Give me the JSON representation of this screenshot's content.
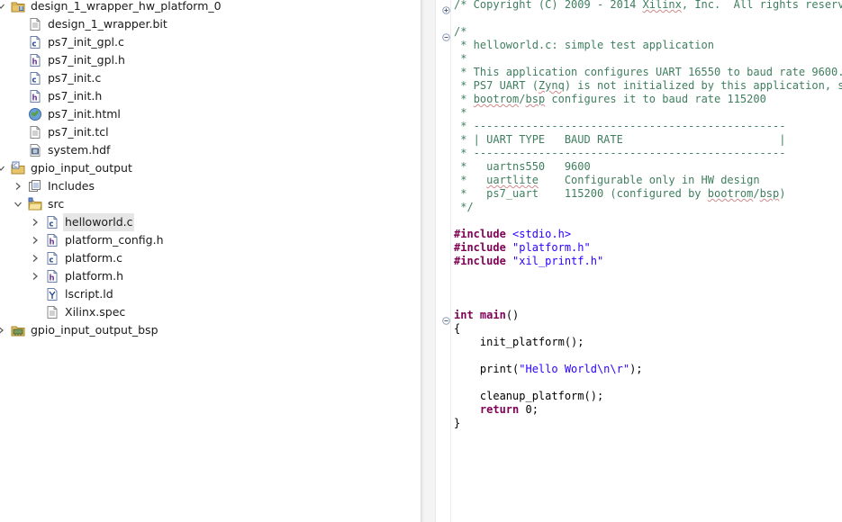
{
  "explorer": {
    "items": [
      {
        "label": "design_1_wrapper_hw_platform_0",
        "icon": "project-folder-icon",
        "depth": 0,
        "expander": "expanded"
      },
      {
        "label": "design_1_wrapper.bit",
        "icon": "text-file-icon",
        "depth": 1,
        "expander": "none"
      },
      {
        "label": "ps7_init_gpl.c",
        "icon": "c-file-icon",
        "depth": 1,
        "expander": "none"
      },
      {
        "label": "ps7_init_gpl.h",
        "icon": "h-file-icon",
        "depth": 1,
        "expander": "none"
      },
      {
        "label": "ps7_init.c",
        "icon": "c-file-icon",
        "depth": 1,
        "expander": "none"
      },
      {
        "label": "ps7_init.h",
        "icon": "h-file-icon",
        "depth": 1,
        "expander": "none"
      },
      {
        "label": "ps7_init.html",
        "icon": "web-file-icon",
        "depth": 1,
        "expander": "none"
      },
      {
        "label": "ps7_init.tcl",
        "icon": "text-file-icon",
        "depth": 1,
        "expander": "none"
      },
      {
        "label": "system.hdf",
        "icon": "hdf-file-icon",
        "depth": 1,
        "expander": "none"
      },
      {
        "label": "gpio_input_output",
        "icon": "c-project-icon",
        "depth": 0,
        "expander": "expanded"
      },
      {
        "label": "Includes",
        "icon": "includes-icon",
        "depth": 1,
        "expander": "collapsed"
      },
      {
        "label": "src",
        "icon": "source-folder-icon",
        "depth": 1,
        "expander": "expanded"
      },
      {
        "label": "helloworld.c",
        "icon": "c-file-icon",
        "depth": 2,
        "expander": "collapsed",
        "selected": true
      },
      {
        "label": "platform_config.h",
        "icon": "h-file-icon",
        "depth": 2,
        "expander": "collapsed"
      },
      {
        "label": "platform.c",
        "icon": "c-file-icon",
        "depth": 2,
        "expander": "collapsed"
      },
      {
        "label": "platform.h",
        "icon": "h-file-icon",
        "depth": 2,
        "expander": "collapsed"
      },
      {
        "label": "lscript.ld",
        "icon": "linker-script-icon",
        "depth": 2,
        "expander": "none"
      },
      {
        "label": "Xilinx.spec",
        "icon": "text-file-icon",
        "depth": 2,
        "expander": "none"
      },
      {
        "label": "gpio_input_output_bsp",
        "icon": "bsp-project-icon",
        "depth": 0,
        "expander": "collapsed"
      }
    ]
  },
  "editor": {
    "lines": [
      {
        "fold": "plus",
        "segs": [
          {
            "t": "/* Copyright (C) 2009 - 2014 ",
            "c": "cm"
          },
          {
            "t": "Xilinx",
            "c": "cm sq"
          },
          {
            "t": ", Inc.  All rights reserved.",
            "c": "cm"
          }
        ]
      },
      {
        "segs": []
      },
      {
        "fold": "minus",
        "segs": [
          {
            "t": "/*",
            "c": "cm"
          }
        ]
      },
      {
        "segs": [
          {
            "t": " * helloworld.c: simple test application",
            "c": "cm"
          }
        ]
      },
      {
        "segs": [
          {
            "t": " *",
            "c": "cm"
          }
        ]
      },
      {
        "segs": [
          {
            "t": " * This application configures UART 16550 to baud rate 9600.",
            "c": "cm"
          }
        ]
      },
      {
        "segs": [
          {
            "t": " * PS7 UART (",
            "c": "cm"
          },
          {
            "t": "Zynq",
            "c": "cm sq"
          },
          {
            "t": ") is not initialized by this application, since",
            "c": "cm"
          }
        ]
      },
      {
        "segs": [
          {
            "t": " * ",
            "c": "cm"
          },
          {
            "t": "bootrom",
            "c": "cm sq"
          },
          {
            "t": "/",
            "c": "cm"
          },
          {
            "t": "bsp",
            "c": "cm sq"
          },
          {
            "t": " configures it to baud rate 115200",
            "c": "cm"
          }
        ]
      },
      {
        "segs": [
          {
            "t": " *",
            "c": "cm"
          }
        ]
      },
      {
        "segs": [
          {
            "t": " * ------------------------------------------------",
            "c": "cm"
          }
        ]
      },
      {
        "segs": [
          {
            "t": " * | UART TYPE   BAUD RATE                        |",
            "c": "cm"
          }
        ]
      },
      {
        "segs": [
          {
            "t": " * ------------------------------------------------",
            "c": "cm"
          }
        ]
      },
      {
        "segs": [
          {
            "t": " *   uartns550   9600",
            "c": "cm"
          }
        ]
      },
      {
        "segs": [
          {
            "t": " *   ",
            "c": "cm"
          },
          {
            "t": "uartlite",
            "c": "cm sq"
          },
          {
            "t": "    Configurable only in HW design",
            "c": "cm"
          }
        ]
      },
      {
        "segs": [
          {
            "t": " *   ps7_uart    115200 (configured by ",
            "c": "cm"
          },
          {
            "t": "bootrom",
            "c": "cm sq"
          },
          {
            "t": "/",
            "c": "cm"
          },
          {
            "t": "bsp",
            "c": "cm sq"
          },
          {
            "t": ")",
            "c": "cm"
          }
        ]
      },
      {
        "segs": [
          {
            "t": " */",
            "c": "cm"
          }
        ]
      },
      {
        "segs": []
      },
      {
        "segs": [
          {
            "t": "#include",
            "c": "kw"
          },
          {
            "t": " ",
            "c": ""
          },
          {
            "t": "<stdio.h>",
            "c": "str"
          }
        ]
      },
      {
        "segs": [
          {
            "t": "#include",
            "c": "kw"
          },
          {
            "t": " ",
            "c": ""
          },
          {
            "t": "\"platform.h\"",
            "c": "str"
          }
        ]
      },
      {
        "segs": [
          {
            "t": "#include",
            "c": "kw"
          },
          {
            "t": " ",
            "c": ""
          },
          {
            "t": "\"xil_printf.h\"",
            "c": "str"
          }
        ]
      },
      {
        "segs": []
      },
      {
        "segs": []
      },
      {
        "segs": []
      },
      {
        "fold": "minus",
        "segs": [
          {
            "t": "int",
            "c": "kw"
          },
          {
            "t": " ",
            "c": ""
          },
          {
            "t": "main",
            "c": "kw"
          },
          {
            "t": "()",
            "c": ""
          }
        ]
      },
      {
        "segs": [
          {
            "t": "{",
            "c": ""
          }
        ]
      },
      {
        "segs": [
          {
            "t": "    init_platform();",
            "c": ""
          }
        ]
      },
      {
        "segs": []
      },
      {
        "segs": [
          {
            "t": "    print(",
            "c": ""
          },
          {
            "t": "\"Hello World\\n\\r\"",
            "c": "str"
          },
          {
            "t": ");",
            "c": ""
          }
        ]
      },
      {
        "segs": []
      },
      {
        "segs": [
          {
            "t": "    cleanup_platform();",
            "c": ""
          }
        ]
      },
      {
        "segs": [
          {
            "t": "    ",
            "c": ""
          },
          {
            "t": "return",
            "c": "kw"
          },
          {
            "t": " 0;",
            "c": ""
          }
        ]
      },
      {
        "segs": [
          {
            "t": "}",
            "c": ""
          }
        ]
      }
    ]
  }
}
